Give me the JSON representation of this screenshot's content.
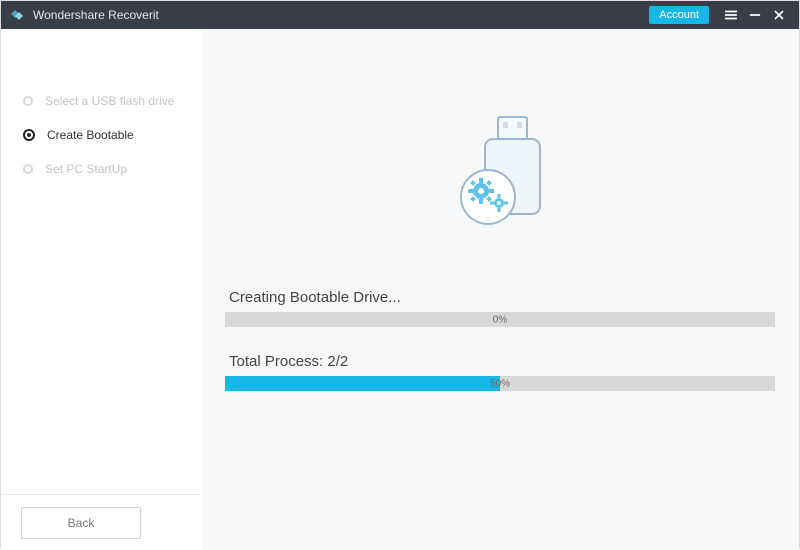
{
  "titlebar": {
    "title": "Wondershare Recoverit",
    "account_label": "Account"
  },
  "sidebar": {
    "steps": [
      {
        "label": "Select a USB flash drive",
        "active": false
      },
      {
        "label": "Create Bootable",
        "active": true
      },
      {
        "label": "Set PC StartUp",
        "active": false
      }
    ],
    "back_label": "Back"
  },
  "main": {
    "progress1": {
      "label": "Creating Bootable Drive...",
      "percent": 0,
      "percent_text": "0%"
    },
    "progress2": {
      "label": "Total Process: 2/2",
      "percent": 50,
      "percent_text": "50%"
    }
  },
  "colors": {
    "accent": "#16b6e5"
  }
}
